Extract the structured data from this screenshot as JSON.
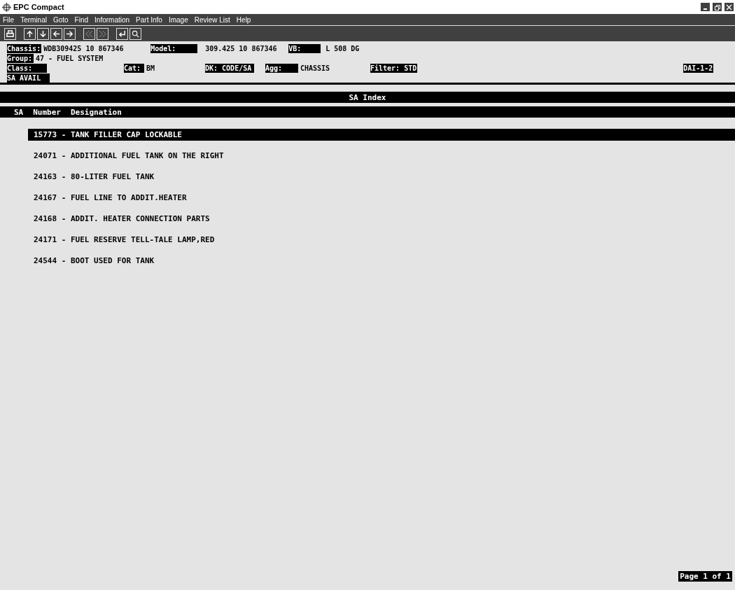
{
  "window": {
    "title": "EPC Compact",
    "controls": [
      {
        "kind": "minimize"
      },
      {
        "kind": "restore"
      },
      {
        "kind": "close"
      }
    ]
  },
  "menu": [
    "File",
    "Terminal",
    "Goto",
    "Find",
    "Information",
    "Part Info",
    "Image",
    "Review List",
    "Help"
  ],
  "toolbar": [
    {
      "kind": "print",
      "disabled": false
    },
    {
      "kind": "up",
      "disabled": false
    },
    {
      "kind": "down",
      "disabled": false
    },
    {
      "kind": "left",
      "disabled": false
    },
    {
      "kind": "right",
      "disabled": false
    },
    {
      "kind": "page-back",
      "disabled": true
    },
    {
      "kind": "page-forward",
      "disabled": true
    },
    {
      "kind": "enter",
      "disabled": false
    },
    {
      "kind": "search",
      "disabled": false
    }
  ],
  "header": [
    [
      {
        "kind": "label",
        "text": "Chassis:"
      },
      {
        "kind": "value",
        "text": "WDB309425 10 867346"
      },
      {
        "kind": "label",
        "text": "Model:"
      },
      {
        "kind": "value",
        "text": "309.425 10 867346"
      },
      {
        "kind": "label",
        "text": "VB:"
      },
      {
        "kind": "value",
        "text": "L 508 DG"
      }
    ],
    [
      {
        "kind": "label",
        "text": "Group:"
      },
      {
        "kind": "value",
        "text": "47 - FUEL SYSTEM"
      }
    ],
    [
      {
        "kind": "label",
        "text": "Class:"
      },
      {
        "kind": "label",
        "text": "Cat:"
      },
      {
        "kind": "value",
        "text": "BM"
      },
      {
        "kind": "label",
        "text": "DK: CODE/SA"
      },
      {
        "kind": "label",
        "text": "Agg:"
      },
      {
        "kind": "value",
        "text": "CHASSIS"
      },
      {
        "kind": "label",
        "text": "Filter: STD"
      },
      {
        "kind": "label",
        "text": "DAI-1-2"
      }
    ],
    [
      {
        "kind": "label",
        "text": "SA AVAIL"
      }
    ]
  ],
  "section_title": "SA Index",
  "columns": [
    "SA",
    "Number",
    "Designation"
  ],
  "rows": [
    {
      "text": "15773 - TANK FILLER CAP LOCKABLE",
      "selected": true
    },
    {
      "text": "24071 - ADDITIONAL FUEL TANK ON THE RIGHT",
      "selected": false
    },
    {
      "text": "24163 - 80-LITER FUEL TANK",
      "selected": false
    },
    {
      "text": "24167 - FUEL LINE TO ADDIT.HEATER",
      "selected": false
    },
    {
      "text": "24168 - ADDIT. HEATER CONNECTION PARTS",
      "selected": false
    },
    {
      "text": "24171 - FUEL RESERVE TELL-TALE LAMP,RED",
      "selected": false
    },
    {
      "text": "24544 - BOOT USED FOR TANK",
      "selected": false
    }
  ],
  "page_indicator": "Page 1 of 1"
}
